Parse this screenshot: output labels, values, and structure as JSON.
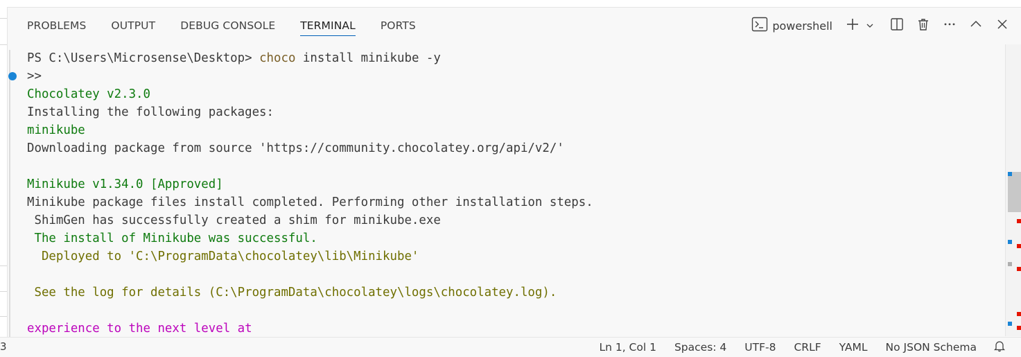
{
  "panel": {
    "tabs": [
      {
        "label": "PROBLEMS",
        "active": false
      },
      {
        "label": "OUTPUT",
        "active": false
      },
      {
        "label": "DEBUG CONSOLE",
        "active": false
      },
      {
        "label": "TERMINAL",
        "active": true
      },
      {
        "label": "PORTS",
        "active": false
      }
    ],
    "terminal_name": "powershell",
    "actions": [
      "new-terminal",
      "launch-profile",
      "split-terminal",
      "kill-terminal",
      "more-actions",
      "maximize-panel",
      "close-panel"
    ]
  },
  "terminal": {
    "prompt": "PS C:\\Users\\Microsense\\Desktop>",
    "command_name": "choco",
    "command_args": "install minikube -y",
    "lines": [
      ">>",
      "Chocolatey v2.3.0",
      "Installing the following packages:",
      "minikube",
      "Downloading package from source 'https://community.chocolatey.org/api/v2/'",
      "",
      "Minikube v1.34.0 [Approved]",
      "Minikube package files install completed. Performing other installation steps.",
      " ShimGen has successfully created a shim for minikube.exe",
      " The install of Minikube was successful.",
      "  Deployed to 'C:\\ProgramData\\chocolatey\\lib\\Minikube'",
      "",
      " See the log for details (C:\\ProgramData\\chocolatey\\logs\\chocolatey.log).",
      "",
      "experience to the next level at"
    ],
    "colors": {
      "default": "#3b3b3b",
      "green": "#0f7b0f",
      "olive": "#6f6f00",
      "yellow": "#949400",
      "magenta": "#bc05bc",
      "command": "#795e26"
    }
  },
  "statusbar": {
    "left_fragment": "3",
    "position": "Ln 1, Col 1",
    "spaces": "Spaces: 4",
    "encoding": "UTF-8",
    "eol": "CRLF",
    "language": "YAML",
    "schema": "No JSON Schema"
  },
  "accent_color": "#005fb8"
}
